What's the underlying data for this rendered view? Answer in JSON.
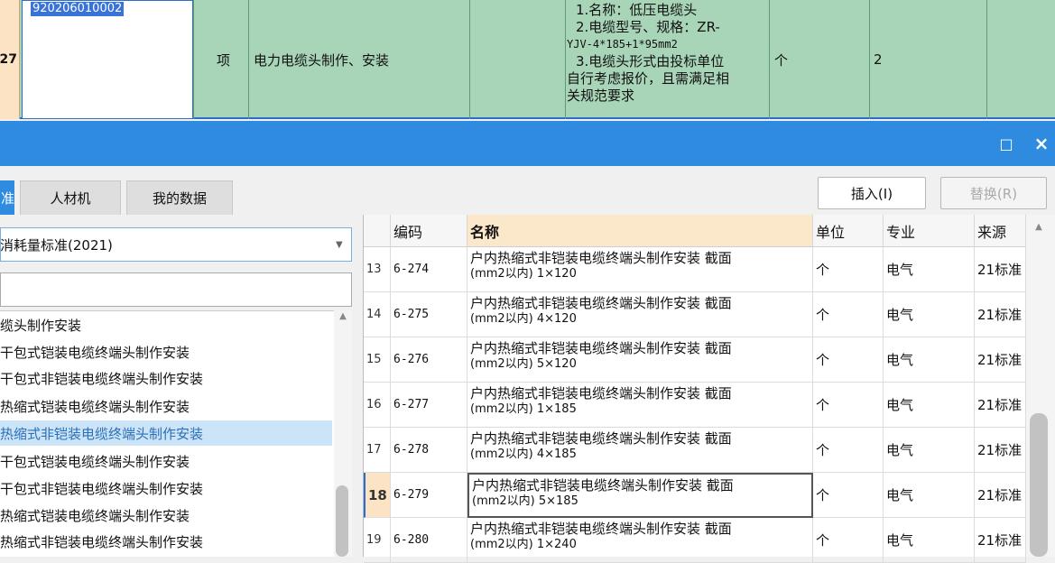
{
  "top_row": {
    "row_number": "27",
    "code": "920206010002",
    "type": "项",
    "name": "电力电缆头制作、安装",
    "description_lines": [
      "1.名称：低压电缆头",
      "2.电缆型号、规格：ZR-",
      "YJV-4*185+1*95mm2",
      "3.电缆头形式由投标单位",
      "自行考虑报价，且需满足相",
      "关规范要求"
    ],
    "unit": "个",
    "quantity": "2"
  },
  "titlebar": {
    "maximize_icon": "□",
    "close_icon": "×"
  },
  "tabs": [
    {
      "label": "准",
      "active": true
    },
    {
      "label": "人材机",
      "active": false
    },
    {
      "label": "我的数据",
      "active": false
    }
  ],
  "actions": {
    "insert_label": "插入(I)",
    "replace_label": "替换(R)"
  },
  "standard_select": {
    "value": "消耗量标准(2021)"
  },
  "search": {
    "value": ""
  },
  "tree_items": [
    "缆头制作安装",
    "干包式铠装电缆终端头制作安装",
    "干包式非铠装电缆终端头制作安装",
    "热缩式铠装电缆终端头制作安装",
    "热缩式非铠装电缆终端头制作安装",
    "干包式铠装电缆终端头制作安装",
    "干包式非铠装电缆终端头制作安装",
    "热缩式铠装电缆终端头制作安装",
    "热缩式非铠装电缆终端头制作安装"
  ],
  "grid": {
    "headers": {
      "code": "编码",
      "name": "名称",
      "unit": "单位",
      "specialty": "专业",
      "source": "来源"
    },
    "rows": [
      {
        "n": "13",
        "code": "6-274",
        "name1": "户内热缩式非铠装电缆终端头制作安装 截面",
        "name2": "(mm2以内) 1×120",
        "unit": "个",
        "specialty": "电气",
        "source": "21标准"
      },
      {
        "n": "14",
        "code": "6-275",
        "name1": "户内热缩式非铠装电缆终端头制作安装 截面",
        "name2": "(mm2以内) 4×120",
        "unit": "个",
        "specialty": "电气",
        "source": "21标准"
      },
      {
        "n": "15",
        "code": "6-276",
        "name1": "户内热缩式非铠装电缆终端头制作安装 截面",
        "name2": "(mm2以内) 5×120",
        "unit": "个",
        "specialty": "电气",
        "source": "21标准"
      },
      {
        "n": "16",
        "code": "6-277",
        "name1": "户内热缩式非铠装电缆终端头制作安装 截面",
        "name2": "(mm2以内) 1×185",
        "unit": "个",
        "specialty": "电气",
        "source": "21标准"
      },
      {
        "n": "17",
        "code": "6-278",
        "name1": "户内热缩式非铠装电缆终端头制作安装 截面",
        "name2": "(mm2以内) 4×185",
        "unit": "个",
        "specialty": "电气",
        "source": "21标准"
      },
      {
        "n": "18",
        "code": "6-279",
        "name1": "户内热缩式非铠装电缆终端头制作安装 截面",
        "name2": "(mm2以内) 5×185",
        "unit": "个",
        "specialty": "电气",
        "source": "21标准"
      },
      {
        "n": "19",
        "code": "6-280",
        "name1": "户内热缩式非铠装电缆终端头制作安装 截面",
        "name2": "(mm2以内) 1×240",
        "unit": "个",
        "specialty": "电气",
        "source": "21标准"
      }
    ],
    "selected_row": 5
  }
}
